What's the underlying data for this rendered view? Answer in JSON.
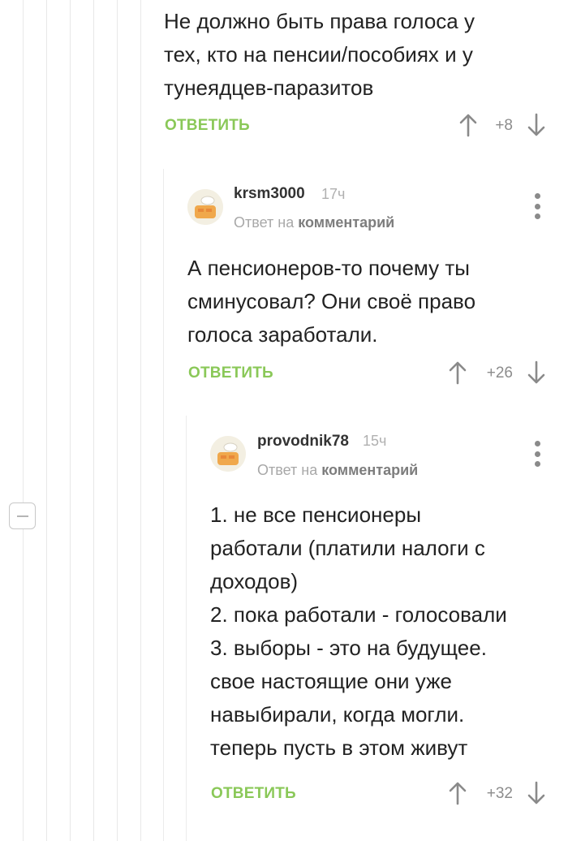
{
  "colors": {
    "reply_link": "#8ac858",
    "vote_text": "#8c8c8c",
    "thread_line": "#e8e8e8"
  },
  "labels": {
    "reply": "ОТВЕТИТЬ",
    "reply_to_prefix": "Ответ на",
    "reply_to_target": "комментарий"
  },
  "comments": [
    {
      "author": "",
      "time": "",
      "lines": [
        "Не должно быть права голоса у",
        "тех, кто на пенсии/пособиях и у",
        "тунеядцев-паразитов"
      ],
      "rating": "+8"
    },
    {
      "author": "krsm3000",
      "time": "17ч",
      "lines": [
        "А пенсионеров-то почему ты",
        "сминусовал? Они своё право",
        "голоса заработали."
      ],
      "rating": "+26"
    },
    {
      "author": "provodnik78",
      "time": "15ч",
      "lines": [
        "1. не все пенсионеры",
        "работали (платили налоги с",
        "доходов)",
        "2. пока работали - голосовали",
        "3. выборы - это на будущее.",
        "свое настоящие они уже",
        "навыбирали, когда могли.",
        "теперь пусть в этом живут"
      ],
      "rating": "+32"
    }
  ],
  "icons": {
    "upvote": "arrow-up-icon",
    "downvote": "arrow-down-icon",
    "menu": "more-vertical-icon",
    "collapse": "minus-icon",
    "avatar": "chef-hat-avatar"
  }
}
